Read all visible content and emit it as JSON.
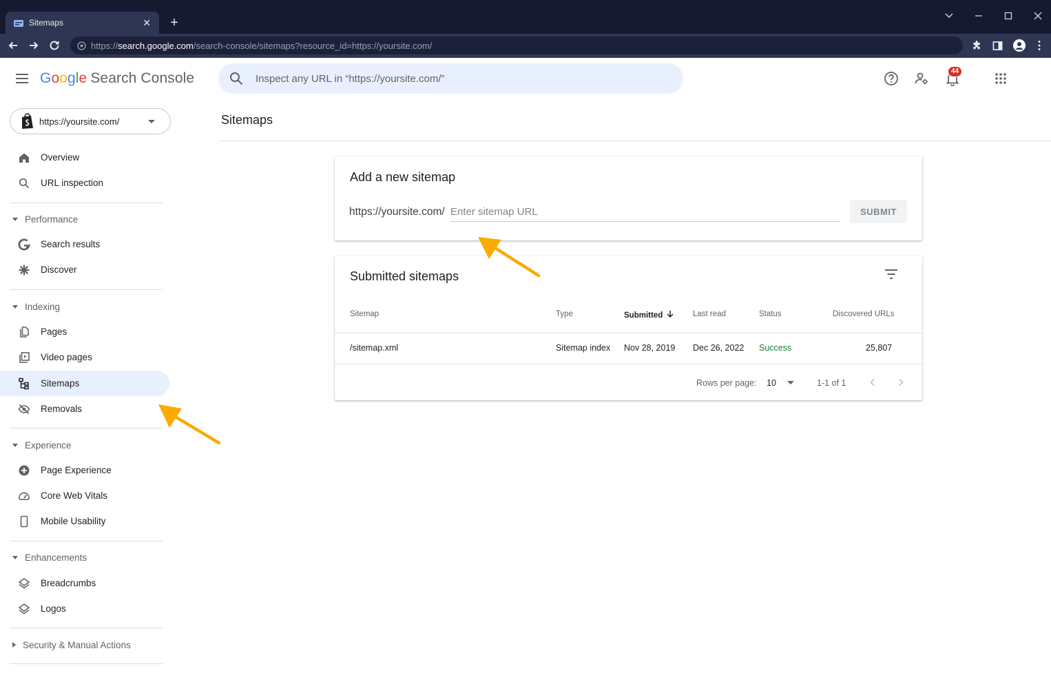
{
  "browser": {
    "tab_title": "Sitemaps",
    "tab_close": "✕",
    "new_tab": "+",
    "url_prefix": "https://",
    "url_host": "search.google.com",
    "url_path": "/search-console/sitemaps?resource_id=https://yoursite.com/"
  },
  "header": {
    "logo_letters": [
      "G",
      "o",
      "o",
      "g",
      "l",
      "e"
    ],
    "product_name": "Search Console",
    "search_placeholder": "Inspect any URL in “https://yoursite.com/”",
    "notification_count": "44"
  },
  "sidebar": {
    "property": "https://yoursite.com/",
    "overview": "Overview",
    "url_inspection": "URL inspection",
    "performance": "Performance",
    "search_results": "Search results",
    "discover": "Discover",
    "indexing": "Indexing",
    "pages": "Pages",
    "video_pages": "Video pages",
    "sitemaps": "Sitemaps",
    "removals": "Removals",
    "experience": "Experience",
    "page_experience": "Page Experience",
    "core_web_vitals": "Core Web Vitals",
    "mobile_usability": "Mobile Usability",
    "enhancements": "Enhancements",
    "breadcrumbs": "Breadcrumbs",
    "logos": "Logos",
    "security": "Security & Manual Actions"
  },
  "main": {
    "page_title": "Sitemaps",
    "add_card": {
      "title": "Add a new sitemap",
      "prefix": "https://yoursite.com/",
      "input_value": "",
      "input_placeholder": "Enter sitemap URL",
      "submit_label": "SUBMIT"
    },
    "submitted_card": {
      "title": "Submitted sitemaps",
      "columns": {
        "sitemap": "Sitemap",
        "type": "Type",
        "submitted": "Submitted",
        "last_read": "Last read",
        "status": "Status",
        "discovered": "Discovered URLs"
      },
      "row": {
        "sitemap": "/sitemap.xml",
        "type": "Sitemap index",
        "submitted": "Nov 28, 2019",
        "last_read": "Dec 26, 2022",
        "status": "Success",
        "discovered": "25,807"
      },
      "rows_per_page_label": "Rows per page:",
      "rows_per_page_value": "10",
      "range": "1-1 of 1"
    }
  },
  "colors": {
    "annotation_arrow": "#f9ab00",
    "active_nav": "#e8f0fe",
    "success": "#188038",
    "badge": "#d93025"
  }
}
